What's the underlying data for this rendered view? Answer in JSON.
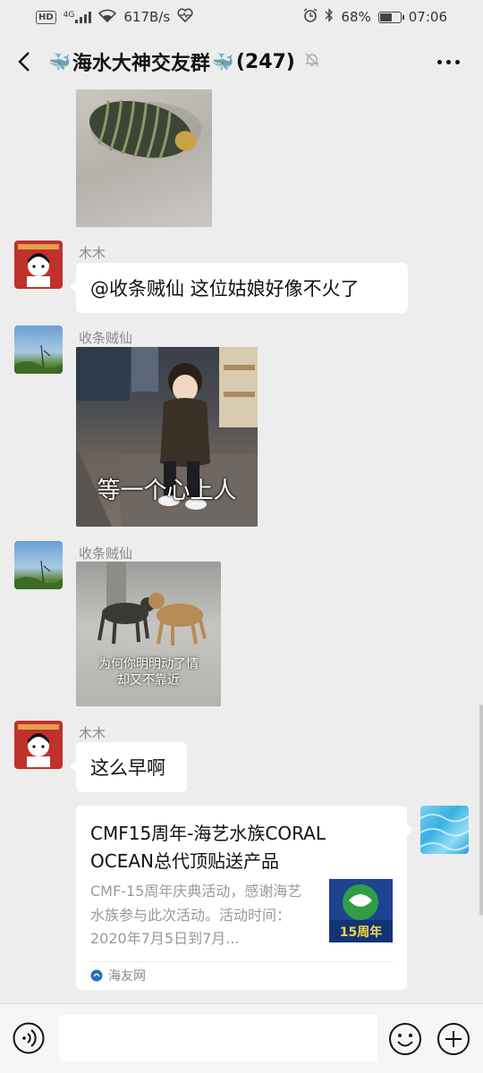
{
  "status_bar": {
    "hd": "HD",
    "network": "4G",
    "speed": "617B/s",
    "battery": "68%",
    "battery_level": 0.68,
    "time": "07:06"
  },
  "header": {
    "title": "海水大神交友群",
    "member_count": "(247)"
  },
  "messages": [
    {
      "type": "image",
      "sender": "",
      "description": "isopod photo"
    },
    {
      "type": "text",
      "sender": "木木",
      "text": "@收条贼仙  这位姑娘好像不火了"
    },
    {
      "type": "image",
      "sender": "收条贼仙",
      "caption": "等一个心上人"
    },
    {
      "type": "image",
      "sender": "收条贼仙",
      "caption_line1": "为何你明明动了情",
      "caption_line2": "却又不靠近"
    },
    {
      "type": "text",
      "sender": "木木",
      "text": "这么早啊"
    },
    {
      "type": "link_card",
      "sender": "self",
      "title": "CMF15周年-海艺水族CORAL OCEAN总代顶贴送产品",
      "desc": "CMF-15周年庆典活动，感谢海艺水族参与此次活动。活动时间：2020年7月5日到7月...",
      "thumb_label": "15周年",
      "source": "海友网"
    }
  ],
  "input": {
    "placeholder": ""
  },
  "colors": {
    "background": "#ededed",
    "bubble": "#ffffff",
    "sender_name": "#888888"
  }
}
